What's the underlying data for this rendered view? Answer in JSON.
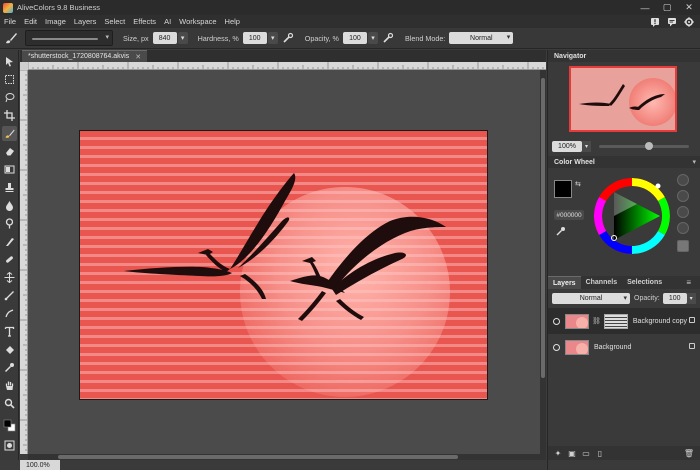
{
  "window": {
    "title": "AliveColors 9.8 Business",
    "controls": [
      "—",
      "▢",
      "✕"
    ]
  },
  "menu": {
    "items": [
      "File",
      "Edit",
      "Image",
      "Layers",
      "Select",
      "Effects",
      "AI",
      "Workspace",
      "Help"
    ],
    "right_icons": [
      "notification-icon",
      "chat-icon",
      "gear-icon"
    ]
  },
  "options": {
    "size_label": "Size, px",
    "size_value": "840",
    "hardness_label": "Hardness, %",
    "hardness_value": "100",
    "opacity_label": "Opacity, %",
    "opacity_value": "100",
    "blend_label": "Blend Mode:",
    "blend_value": "Normal"
  },
  "document": {
    "tab_title": "*shutterstock_1720808764.akvis",
    "close": "✕",
    "zoom_status": "100.0%"
  },
  "navigator": {
    "title": "Navigator",
    "zoom_value": "100%"
  },
  "color_wheel": {
    "title": "Color Wheel",
    "hex": "#000000",
    "foreground": "#000000",
    "background": "#ffffff"
  },
  "layers": {
    "tabs": [
      "Layers",
      "Channels",
      "Selections"
    ],
    "blend_value": "Normal",
    "opacity_label": "Opacity:",
    "opacity_value": "100",
    "items": [
      {
        "name": "Background copy"
      },
      {
        "name": "Background"
      }
    ]
  },
  "colors": {
    "image_red": "#e9554f",
    "sun_pink": "#f68f88",
    "accent_border": "#e63b3b"
  }
}
